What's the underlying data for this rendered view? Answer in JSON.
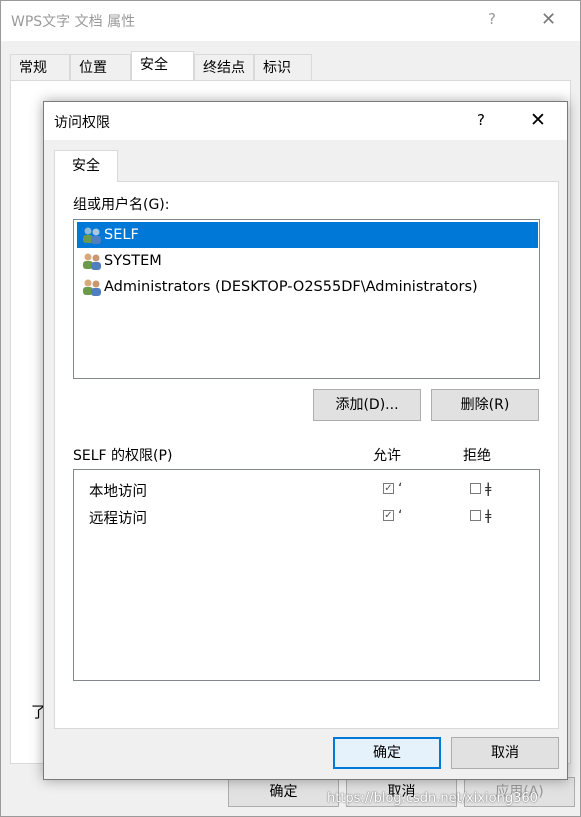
{
  "bg_window": {
    "title": "WPS文字 文档 属性",
    "help": "?",
    "close": "✕",
    "tabs": [
      "常规",
      "位置",
      "安全",
      "终结点",
      "标识"
    ],
    "partial_text": "了",
    "buttons": {
      "ok": "确定",
      "cancel": "取消",
      "apply": "应用(A)"
    }
  },
  "dialog": {
    "title": "访问权限",
    "help": "?",
    "close": "✕",
    "tab": "安全",
    "group_label": "组或用户名(G):",
    "users": [
      {
        "name": "SELF",
        "selected": true
      },
      {
        "name": "SYSTEM",
        "selected": false
      },
      {
        "name": "Administrators (DESKTOP-O2S55DF\\Administrators)",
        "selected": false
      }
    ],
    "add_button": "添加(D)...",
    "remove_button": "删除(R)",
    "perm_label": "SELF 的权限(P)",
    "allow_header": "允许",
    "deny_header": "拒绝",
    "permissions": [
      {
        "name": "本地访问",
        "allow": true,
        "deny": false
      },
      {
        "name": "远程访问",
        "allow": true,
        "deny": false
      }
    ],
    "ok_button": "确定",
    "cancel_button": "取消"
  },
  "watermark": "https://blog.csdn.net/xixiong360",
  "colors": {
    "selection": "#0078d7",
    "accent_border": "#0078d7"
  }
}
